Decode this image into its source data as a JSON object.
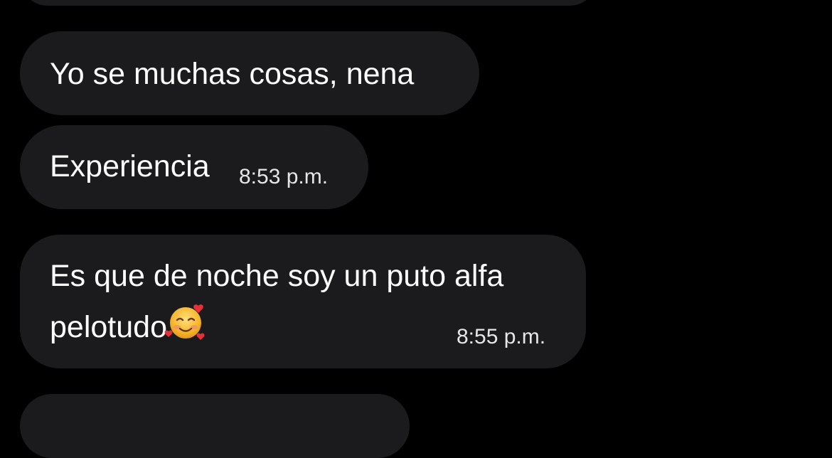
{
  "messages": [
    {
      "text": ""
    },
    {
      "text": "Yo se muchas cosas, nena"
    },
    {
      "text": "Experiencia",
      "time": "8:53 p.m."
    },
    {
      "lines": [
        "Es que de noche soy un puto alfa",
        "pelotudo"
      ],
      "time": "8:55 p.m.",
      "emoji": "smiling-face-with-hearts-icon"
    },
    {
      "text": ""
    }
  ],
  "colors": {
    "background": "#000000",
    "bubble": "#1b1b1d",
    "text": "#ffffff"
  }
}
